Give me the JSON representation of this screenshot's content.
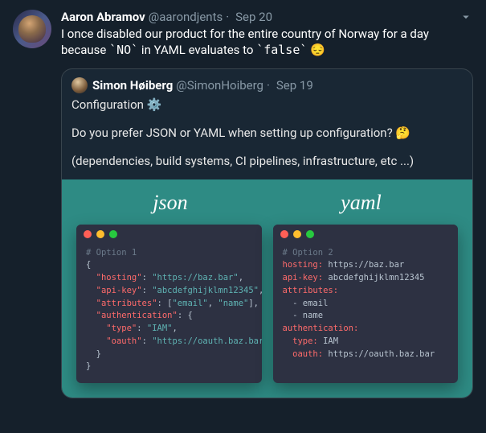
{
  "tweet": {
    "author_name": "Aaron Abramov",
    "author_handle": "@aarondjents",
    "date": "Sep 20",
    "text_part1": "I once disabled our product for the entire country of Norway for a day because ",
    "code1": "`NO`",
    "text_part2": " in YAML evaluates to ",
    "code2": "`false`",
    "emoji": "😔"
  },
  "quoted": {
    "author_name": "Simon Høiberg",
    "author_handle": "@SimonHoiberg",
    "date": "Sep 19",
    "line1_a": "Configuration ",
    "line1_gear": "⚙️",
    "line2_a": "Do you prefer JSON or YAML when setting up configuration? ",
    "line2_emoji": "🤔",
    "line3": "(dependencies, build systems, CI pipelines, infrastructure, etc ...)"
  },
  "image": {
    "title_left": "json",
    "title_right": "yaml",
    "json": {
      "comment": "# Option 1",
      "hosting_key": "\"hosting\"",
      "hosting_val": "\"https://baz.bar\"",
      "apikey_key": "\"api-key\"",
      "apikey_val": "\"abcdefghijklmn12345\"",
      "attr_key": "\"attributes\"",
      "attr_val1": "\"email\"",
      "attr_val2": "\"name\"",
      "auth_key": "\"authentication\"",
      "type_key": "\"type\"",
      "type_val": "\"IAM\"",
      "oauth_key": "\"oauth\"",
      "oauth_val": "\"https://oauth.baz.bar\""
    },
    "yaml": {
      "comment": "# Option 2",
      "hosting_key": "hosting:",
      "hosting_val": " https://baz.bar",
      "apikey_key": "api-key:",
      "apikey_val": " abcdefghijklmn12345",
      "attr_key": "attributes:",
      "attr_v1": "  - email",
      "attr_v2": "  - name",
      "auth_key": "authentication:",
      "type_key": "  type:",
      "type_val": " IAM",
      "oauth_key": "  oauth:",
      "oauth_val": " https://oauth.baz.bar"
    }
  }
}
